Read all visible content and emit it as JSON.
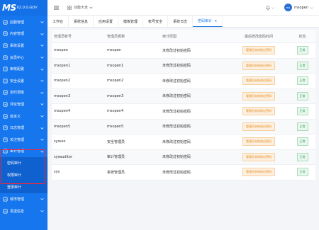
{
  "app": {
    "logo_main": "MS",
    "logo_version": "V2.0.0.GOV"
  },
  "sidebar": {
    "items": [
      {
        "label": "后勤管理",
        "icon": "building-icon"
      },
      {
        "label": "内容管理",
        "icon": "document-icon"
      },
      {
        "label": "系统设置",
        "icon": "gear-icon"
      },
      {
        "label": "会员中心",
        "icon": "user-icon"
      },
      {
        "label": "审核配置",
        "icon": "audit-icon"
      },
      {
        "label": "安全设置",
        "icon": "shield-icon"
      },
      {
        "label": "定时调度",
        "icon": "clock-icon"
      },
      {
        "label": "评论管理",
        "icon": "comment-icon"
      },
      {
        "label": "自定义",
        "icon": "custom-icon"
      },
      {
        "label": "日志管理",
        "icon": "log-icon"
      },
      {
        "label": "关注管理",
        "icon": "star-icon"
      },
      {
        "label": "审计管理",
        "icon": "audit-log-icon"
      }
    ],
    "sub_items": [
      {
        "label": "密码审计"
      },
      {
        "label": "权限审计"
      },
      {
        "label": "登录审计"
      }
    ],
    "bottom_items": [
      {
        "label": "城市管理",
        "icon": "city-icon"
      },
      {
        "label": "发送信息",
        "icon": "mail-icon"
      }
    ]
  },
  "topbar": {
    "func_label": "功能大全",
    "username": "msopen",
    "avatar_text": "ms"
  },
  "tabs": [
    {
      "label": "工作台"
    },
    {
      "label": "系统信息"
    },
    {
      "label": "应用设置"
    },
    {
      "label": "模板管理"
    },
    {
      "label": "帐号安全"
    },
    {
      "label": "系统日志"
    },
    {
      "label": "密码审计",
      "close": "×"
    }
  ],
  "table": {
    "headers": [
      "管理员帐号",
      "管理员昵称",
      "审计原因",
      "最后修改密码时间",
      "状态"
    ],
    "rows": [
      {
        "account": "msopen",
        "nickname": "msopen",
        "reason": "未修改过初始密码",
        "last_change": "管理员未修改过密码",
        "status": "正常"
      },
      {
        "account": "msopen1",
        "nickname": "msopen1",
        "reason": "未修改过初始密码",
        "last_change": "管理员未修改过密码",
        "status": "正常"
      },
      {
        "account": "msopen2",
        "nickname": "msopen2",
        "reason": "未修改过初始密码",
        "last_change": "管理员未修改过密码",
        "status": "正常"
      },
      {
        "account": "msopen3",
        "nickname": "msopen3",
        "reason": "未修改过初始密码",
        "last_change": "管理员未修改过密码",
        "status": "正常"
      },
      {
        "account": "msopen4",
        "nickname": "msopen4",
        "reason": "未修改过初始密码",
        "last_change": "管理员未修改过密码",
        "status": "正常"
      },
      {
        "account": "msopen5",
        "nickname": "msopen5",
        "reason": "未修改过初始密码",
        "last_change": "管理员未修改过密码",
        "status": "正常"
      },
      {
        "account": "syssso",
        "nickname": "安全管理员",
        "reason": "未修改过初始密码",
        "last_change": "管理员未修改过密码",
        "status": "正常"
      },
      {
        "account": "sysauditor",
        "nickname": "审计管理员",
        "reason": "未修改过初始密码",
        "last_change": "管理员未修改过密码",
        "status": "正常"
      },
      {
        "account": "sys",
        "nickname": "系统管理员",
        "reason": "未修改过初始密码",
        "last_change": "管理员未修改过密码",
        "status": "正常"
      }
    ]
  },
  "colors": {
    "sidebar": "#1676ee",
    "accent": "#1e7be8",
    "warn": "#e38a18",
    "ok": "#2c9f57",
    "highlight_box": "#f0263a"
  }
}
